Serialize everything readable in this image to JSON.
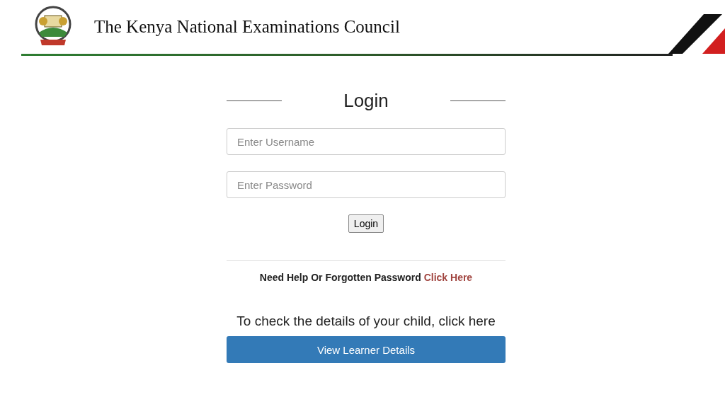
{
  "header": {
    "title": "The Kenya National Examinations Council"
  },
  "login": {
    "heading": "Login",
    "fields": [
      {
        "placeholder": "Enter Username"
      },
      {
        "placeholder": "Enter Password"
      }
    ],
    "button": "Login",
    "help": {
      "text": "Need Help Or Forgotten Password",
      "link": "Click Here"
    }
  },
  "learner": {
    "prompt": "To check the details of your child, click here",
    "button": "View Learner Details"
  }
}
